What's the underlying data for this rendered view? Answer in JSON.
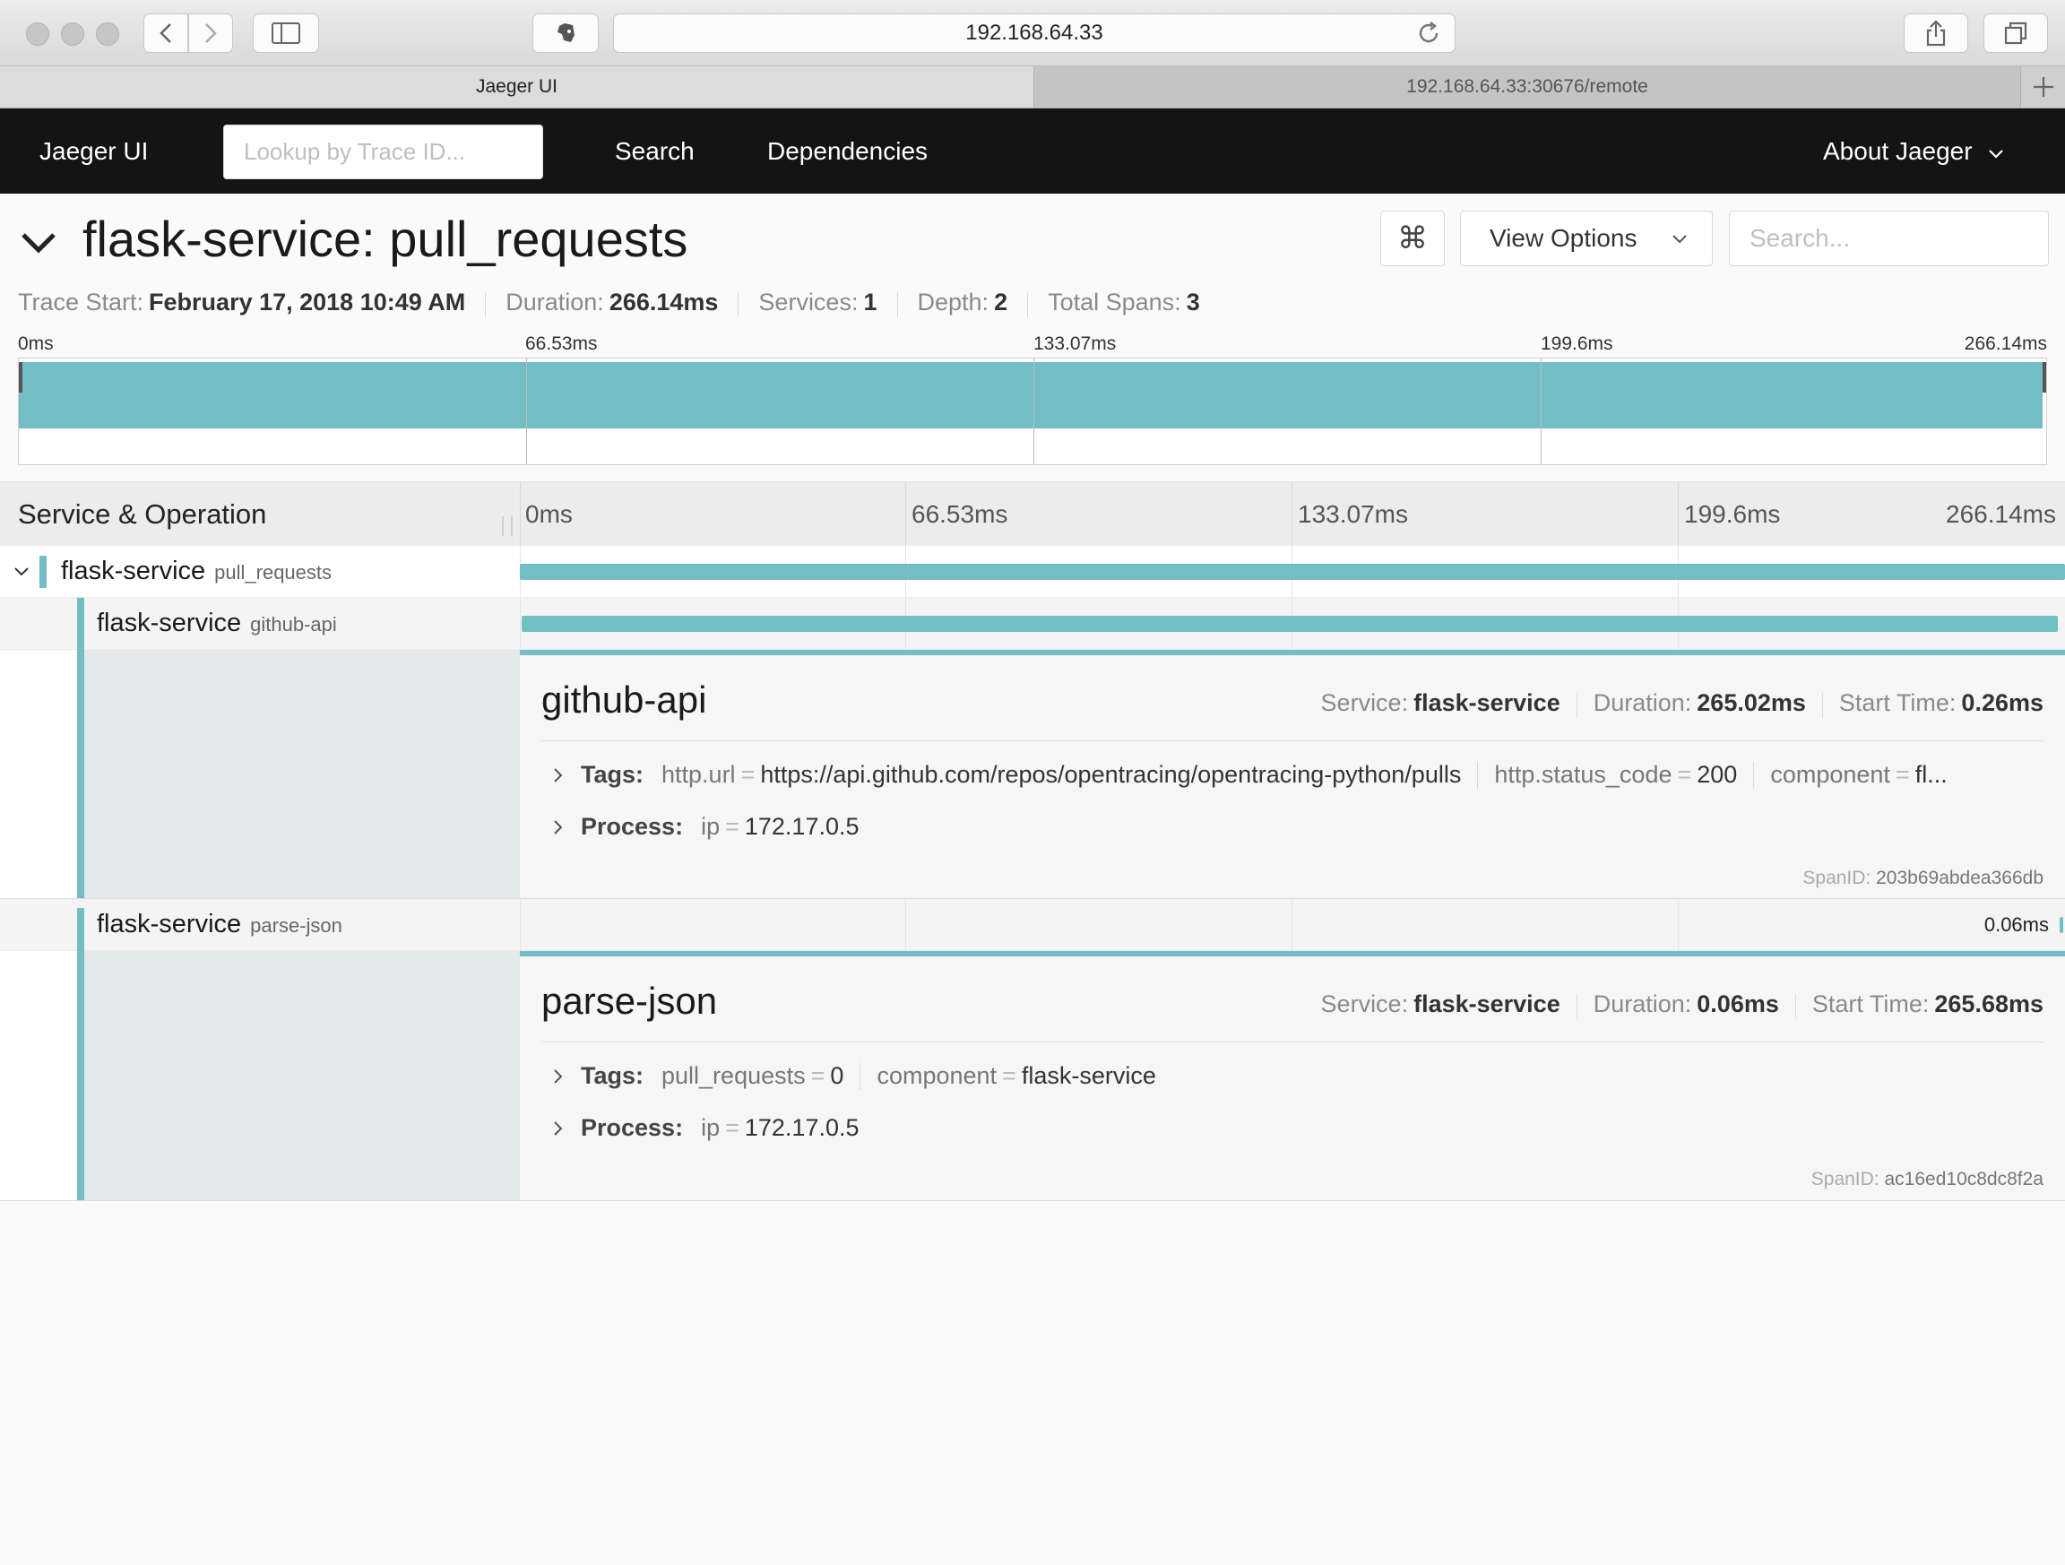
{
  "browser": {
    "url": "192.168.64.33",
    "tabs": [
      {
        "label": "Jaeger UI"
      },
      {
        "label": "192.168.64.33:30676/remote"
      }
    ]
  },
  "nav": {
    "brand": "Jaeger UI",
    "lookup_placeholder": "Lookup by Trace ID...",
    "search": "Search",
    "dependencies": "Dependencies",
    "about": "About Jaeger"
  },
  "trace": {
    "title": "flask-service: pull_requests",
    "view_options": "View Options",
    "search_placeholder": "Search...",
    "kbd_icon": "⌘",
    "meta": {
      "start_label": "Trace Start:",
      "start": "February 17, 2018 10:49 AM",
      "duration_label": "Duration:",
      "duration": "266.14ms",
      "services_label": "Services:",
      "services": "1",
      "depth_label": "Depth:",
      "depth": "2",
      "spans_label": "Total Spans:",
      "spans": "3"
    }
  },
  "minimap": {
    "ticks": [
      "0ms",
      "66.53ms",
      "133.07ms",
      "199.6ms",
      "266.14ms"
    ]
  },
  "timeline": {
    "header": "Service & Operation",
    "ticks": [
      "0ms",
      "66.53ms",
      "133.07ms",
      "199.6ms",
      "266.14ms"
    ]
  },
  "spans": [
    {
      "service": "flask-service",
      "operation": "pull_requests"
    },
    {
      "service": "flask-service",
      "operation": "github-api"
    },
    {
      "service": "flask-service",
      "operation": "parse-json",
      "duration_label": "0.06ms"
    }
  ],
  "details": [
    {
      "title": "github-api",
      "service_label": "Service:",
      "service": "flask-service",
      "duration_label": "Duration:",
      "duration": "265.02ms",
      "start_label": "Start Time:",
      "start": "0.26ms",
      "tags_label": "Tags:",
      "tags": [
        {
          "key": "http.url",
          "value": "https://api.github.com/repos/opentracing/opentracing-python/pulls"
        },
        {
          "key": "http.status_code",
          "value": "200"
        },
        {
          "key": "component",
          "value": "fl..."
        }
      ],
      "process_label": "Process:",
      "process": {
        "key": "ip",
        "value": "172.17.0.5"
      },
      "spanid_label": "SpanID:",
      "spanid": "203b69abdea366db"
    },
    {
      "title": "parse-json",
      "service_label": "Service:",
      "service": "flask-service",
      "duration_label": "Duration:",
      "duration": "0.06ms",
      "start_label": "Start Time:",
      "start": "265.68ms",
      "tags_label": "Tags:",
      "tags": [
        {
          "key": "pull_requests",
          "value": "0"
        },
        {
          "key": "component",
          "value": "flask-service"
        }
      ],
      "process_label": "Process:",
      "process": {
        "key": "ip",
        "value": "172.17.0.5"
      },
      "spanid_label": "SpanID:",
      "spanid": "ac16ed10c8dc8f2a"
    }
  ]
}
